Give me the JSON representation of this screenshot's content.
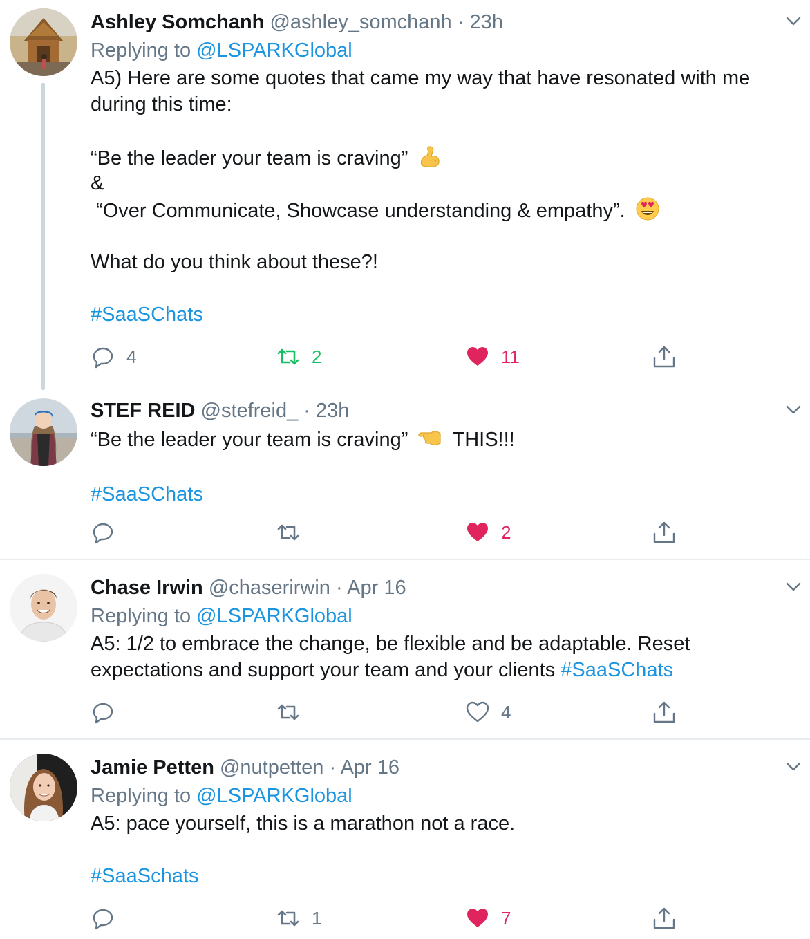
{
  "colors": {
    "text": "#14171a",
    "secondary": "#657786",
    "link": "#1b95e0",
    "like": "#e0245e",
    "retweet": "#17bf63",
    "divider": "#e6ecf0"
  },
  "tweets": [
    {
      "name": "Ashley Somchanh",
      "handle": "@ashley_somchanh",
      "sep": "·",
      "time": "23h",
      "replying_prefix": "Replying to",
      "replying_to": "@LSPARKGlobal",
      "lines": [
        "A5) Here are some quotes that came my way that have resonated with me",
        "during this time:",
        "“Be the leader your team is craving”",
        "&",
        " “Over Communicate, Showcase understanding & empathy”.",
        "What do you think about these?!"
      ],
      "emojis": [
        "flexed-biceps",
        "heart-eyes"
      ],
      "hashtag": "#SaaSChats",
      "replies": "4",
      "retweets": "2",
      "likes": "11"
    },
    {
      "name": "STEF REID",
      "handle": "@stefreid_",
      "sep": "·",
      "time": "23h",
      "line_before": "“Be the leader your team is craving”",
      "line_after": "THIS!!!",
      "emojis": [
        "pointing-left-hand"
      ],
      "hashtag": "#SaaSChats",
      "likes": "2"
    },
    {
      "name": "Chase Irwin",
      "handle": "@chaserirwin",
      "sep": "·",
      "time": "Apr 16",
      "replying_prefix": "Replying to",
      "replying_to": "@LSPARKGlobal",
      "lines": [
        "A5: 1/2 to embrace the change, be flexible and be adaptable. Reset",
        "expectations and support your team and your clients"
      ],
      "hashtag": "#SaaSChats",
      "likes": "4"
    },
    {
      "name": "Jamie Petten",
      "handle": "@nutpetten",
      "sep": "·",
      "time": "Apr 16",
      "replying_prefix": "Replying to",
      "replying_to": "@LSPARKGlobal",
      "lines": [
        "A5: pace yourself, this is a marathon not a race."
      ],
      "hashtag": "#SaaSchats",
      "retweets": "1",
      "likes": "7"
    }
  ],
  "icons": [
    "reply-icon",
    "retweet-icon",
    "like-icon",
    "share-icon",
    "chevron-down-icon"
  ]
}
